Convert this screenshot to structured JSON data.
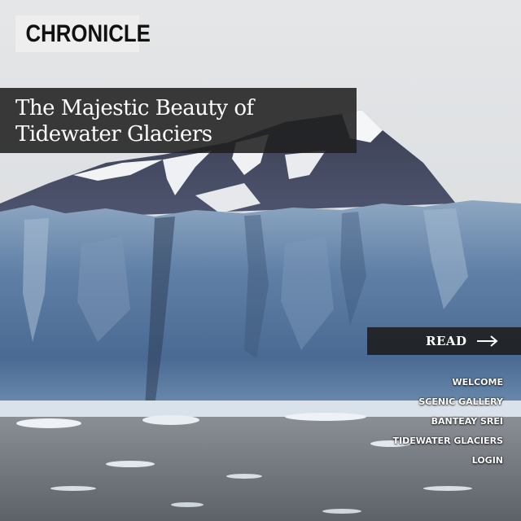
{
  "brand": {
    "logo_text": "CHRONICLE"
  },
  "hero": {
    "title_line1": "The Majestic Beauty of",
    "title_line2": "Tidewater Glaciers",
    "image_subject": "tidewater-glacier-photo"
  },
  "cta": {
    "read_label": "READ",
    "arrow_icon": "arrow-right-icon"
  },
  "nav": {
    "items": [
      {
        "label": "WELCOME"
      },
      {
        "label": "SCENIC GALLERY"
      },
      {
        "label": "BANTEAY SREI"
      },
      {
        "label": "TIDEWATER GLACIERS"
      },
      {
        "label": "LOGIN"
      }
    ]
  },
  "colors": {
    "overlay_dark": "#202020",
    "logo_bg": "#eeeeee",
    "text_light": "#ffffff",
    "glacier_blue": "#6f8fb3"
  }
}
